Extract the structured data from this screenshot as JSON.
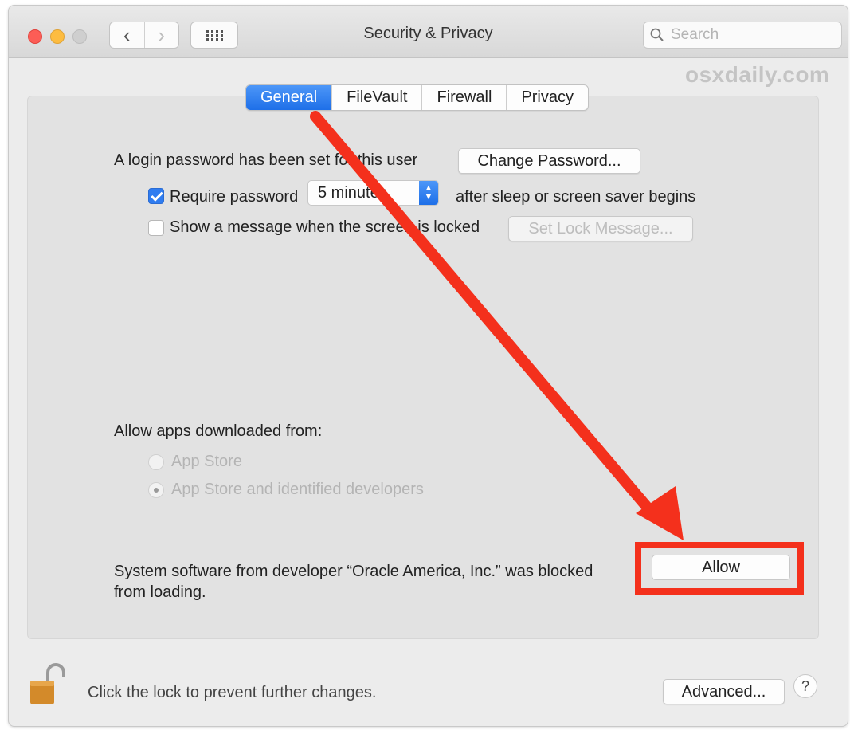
{
  "window": {
    "title": "Security & Privacy"
  },
  "toolbar": {
    "back_glyph": "‹",
    "forward_glyph": "›",
    "search_placeholder": "Search"
  },
  "watermark": "osxdaily.com",
  "tabs": [
    {
      "label": "General",
      "active": true
    },
    {
      "label": "FileVault",
      "active": false
    },
    {
      "label": "Firewall",
      "active": false
    },
    {
      "label": "Privacy",
      "active": false
    }
  ],
  "general": {
    "login_password_text": "A login password has been set for this user",
    "change_password_label": "Change Password...",
    "require_password": {
      "checked": true,
      "label": "Require password",
      "delay_value": "5 minutes",
      "suffix": "after sleep or screen saver begins"
    },
    "show_message": {
      "checked": false,
      "label": "Show a message when the screen is locked",
      "button_label": "Set Lock Message..."
    },
    "allow_apps": {
      "heading": "Allow apps downloaded from:",
      "options": [
        {
          "label": "App Store",
          "selected": false
        },
        {
          "label": "App Store and identified developers",
          "selected": true
        }
      ]
    },
    "blocked": {
      "line1": "System software from developer “Oracle America, Inc.” was blocked",
      "line2": "from loading.",
      "allow_label": "Allow"
    }
  },
  "footer": {
    "lock_text": "Click the lock to prevent further changes.",
    "advanced_label": "Advanced...",
    "help_label": "?"
  },
  "colors": {
    "accent_blue": "#2f7cf0",
    "annotation_red": "#f4301c",
    "window_bg": "#ececec",
    "panel_bg": "#e2e2e2"
  }
}
